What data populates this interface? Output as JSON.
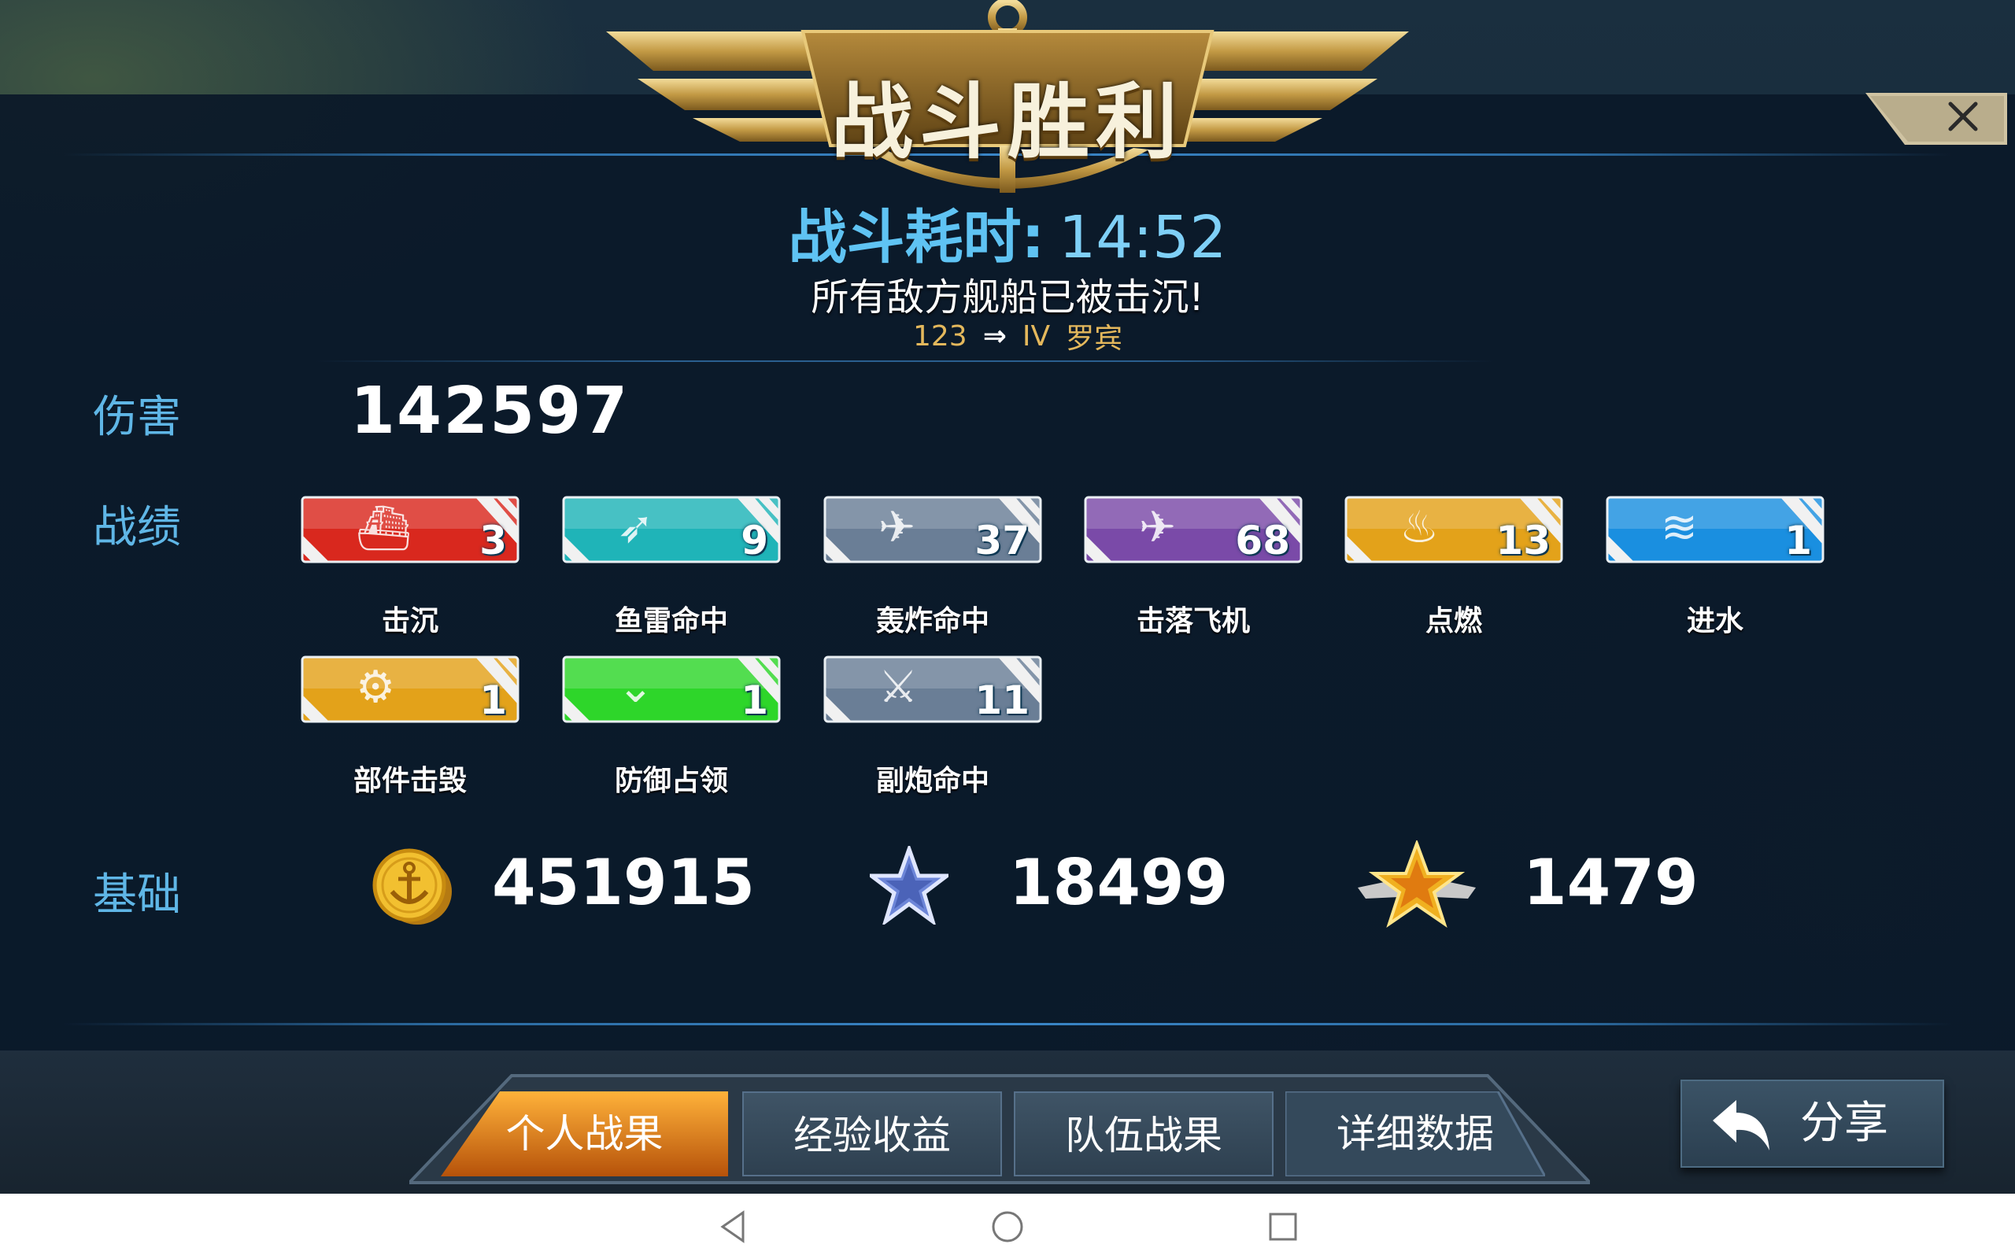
{
  "header": {
    "title": "战斗胜利",
    "duration_label": "战斗耗时:",
    "duration_value": "14:52",
    "result_message": "所有敌方舰船已被击沉!",
    "player_level": "123",
    "player_tier": "IV",
    "player_name": "罗宾"
  },
  "damage": {
    "label": "伤害",
    "value": "142597"
  },
  "record": {
    "label": "战绩",
    "badges": [
      {
        "caption": "击沉",
        "count": "3",
        "icon": "ship-icon",
        "color": "#d9281e"
      },
      {
        "caption": "鱼雷命中",
        "count": "9",
        "icon": "torpedo-icon",
        "color": "#1fb4b8"
      },
      {
        "caption": "轰炸命中",
        "count": "37",
        "icon": "bomber-icon",
        "color": "#6a7e96"
      },
      {
        "caption": "击落飞机",
        "count": "68",
        "icon": "planes-icon",
        "color": "#7a4aa8"
      },
      {
        "caption": "点燃",
        "count": "13",
        "icon": "fire-icon",
        "color": "#e3a21a"
      },
      {
        "caption": "进水",
        "count": "1",
        "icon": "flood-icon",
        "color": "#1a8fe0"
      },
      {
        "caption": "部件击毁",
        "count": "1",
        "icon": "gear-icon",
        "color": "#e3a21a"
      },
      {
        "caption": "防御占领",
        "count": "1",
        "icon": "shield-chevron-icon",
        "color": "#2ed62a"
      },
      {
        "caption": "副炮命中",
        "count": "11",
        "icon": "turret-icon",
        "color": "#6a7e96"
      }
    ]
  },
  "base": {
    "label": "基础",
    "coins": {
      "value": "451915",
      "icon": "anchor-coin-icon"
    },
    "exp": {
      "value": "18499",
      "icon": "blue-star-icon"
    },
    "merit": {
      "value": "1479",
      "icon": "winged-gold-star-icon"
    }
  },
  "tabs": [
    {
      "label": "个人战果",
      "active": true
    },
    {
      "label": "经验收益",
      "active": false
    },
    {
      "label": "队伍战果",
      "active": false
    },
    {
      "label": "详细数据",
      "active": false
    }
  ],
  "share": {
    "label": "分享"
  }
}
